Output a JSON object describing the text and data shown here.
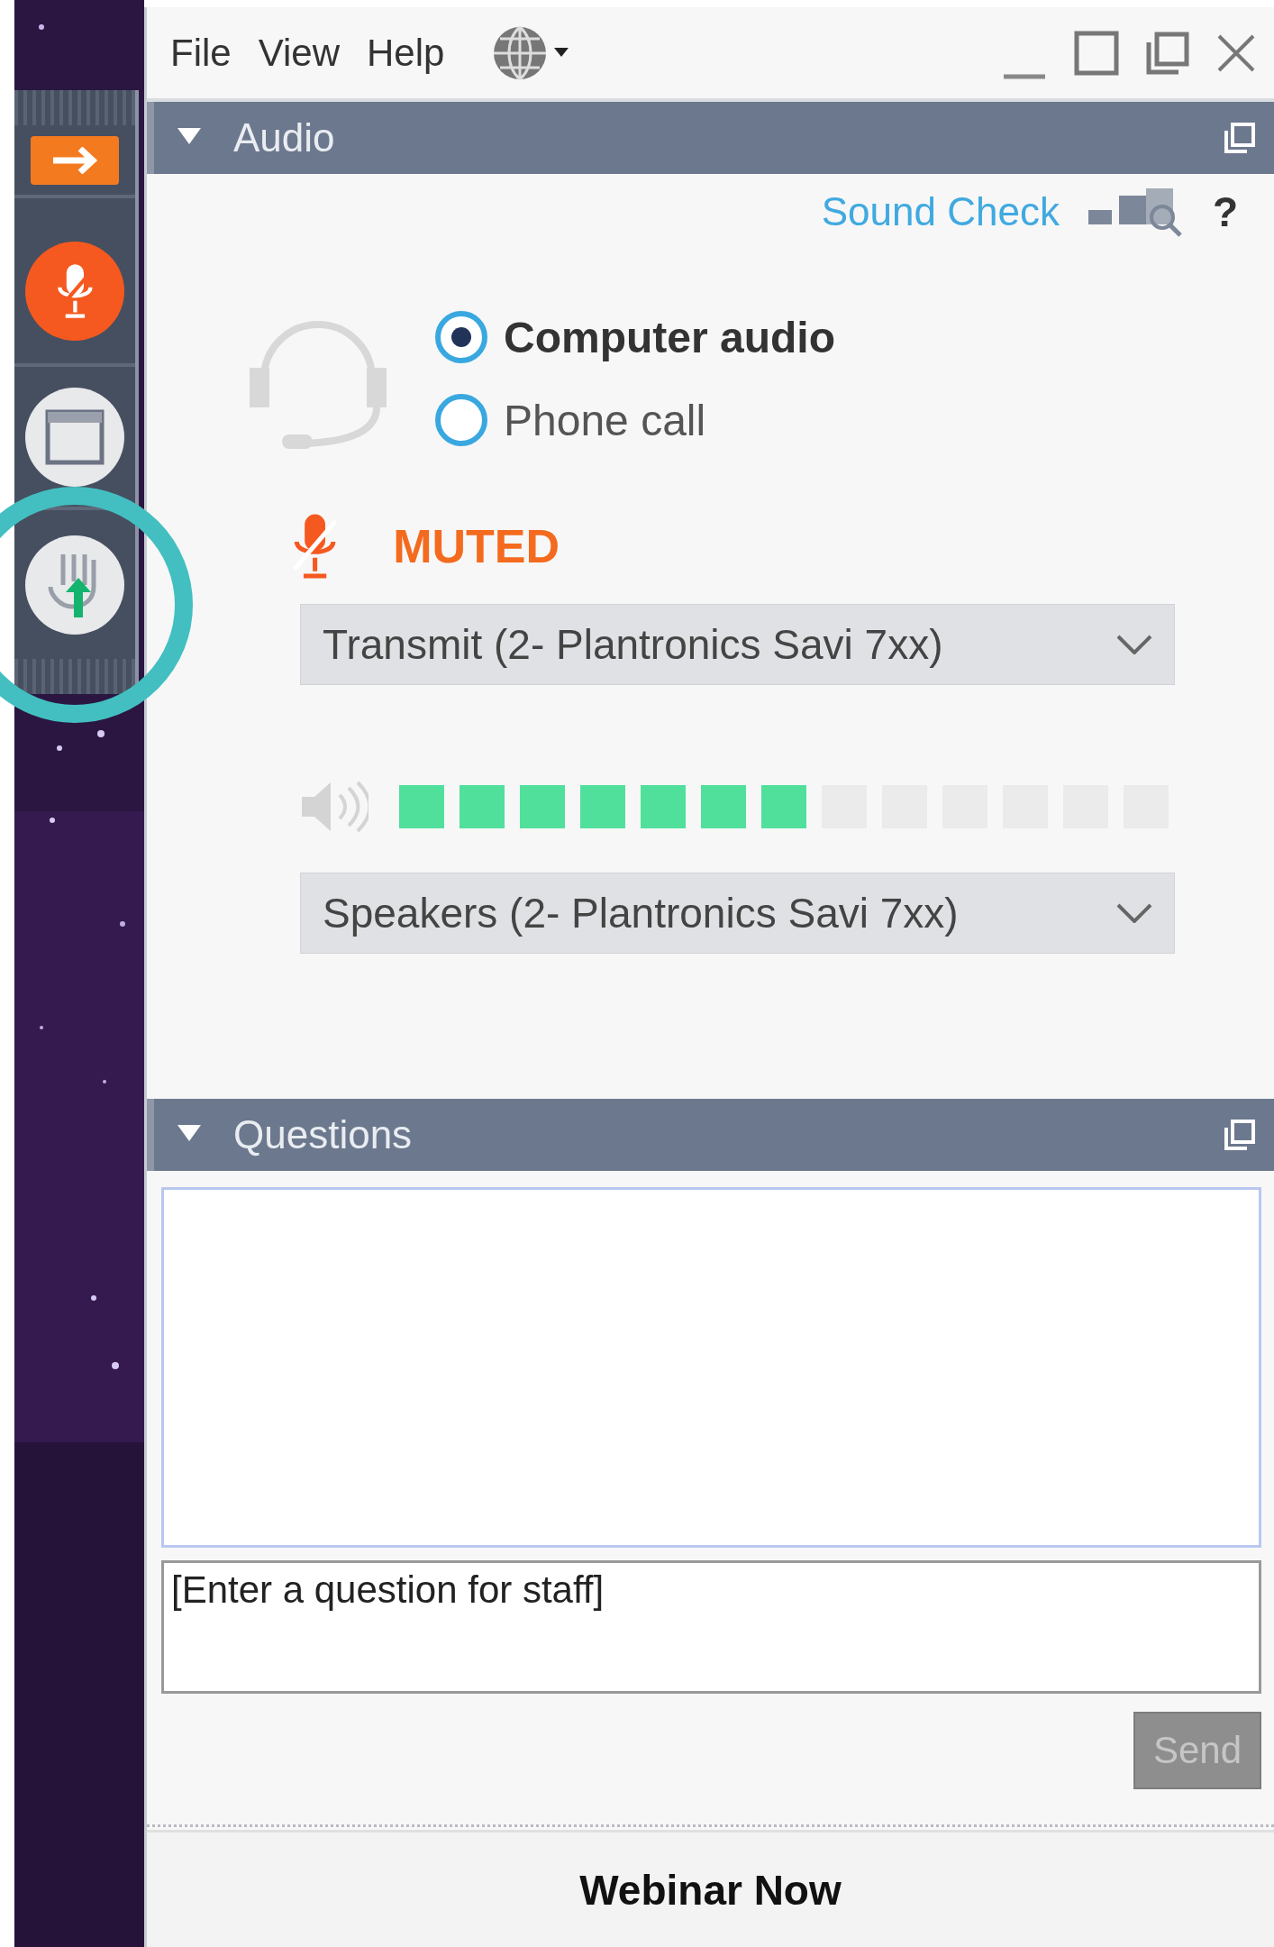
{
  "menu": [
    {
      "label": "File"
    },
    {
      "label": "View"
    },
    {
      "label": "Help"
    }
  ],
  "sidebar": {
    "buttons": [
      {
        "kind": "arrow"
      },
      {
        "kind": "mic"
      },
      {
        "kind": "panel"
      },
      {
        "kind": "hand"
      }
    ]
  },
  "audio": {
    "title": "Audio",
    "expanded": true,
    "sound_check": "Sound Check",
    "help": "?",
    "modes": [
      {
        "label": "Computer audio",
        "selected": true
      },
      {
        "label": "Phone call",
        "selected": false
      }
    ],
    "mic_status": "MUTED",
    "transmit": "Transmit (2- Plantronics Savi 7xx)",
    "meter": {
      "level": 0.54
    },
    "speakers": "Speakers (2- Plantronics Savi 7xx)"
  },
  "questions": {
    "title": "Questions",
    "expanded": true,
    "placeholder": "[Enter a question for staff]",
    "send": {
      "label": "Send",
      "disabled": true
    }
  },
  "footer": "Webinar Now"
}
